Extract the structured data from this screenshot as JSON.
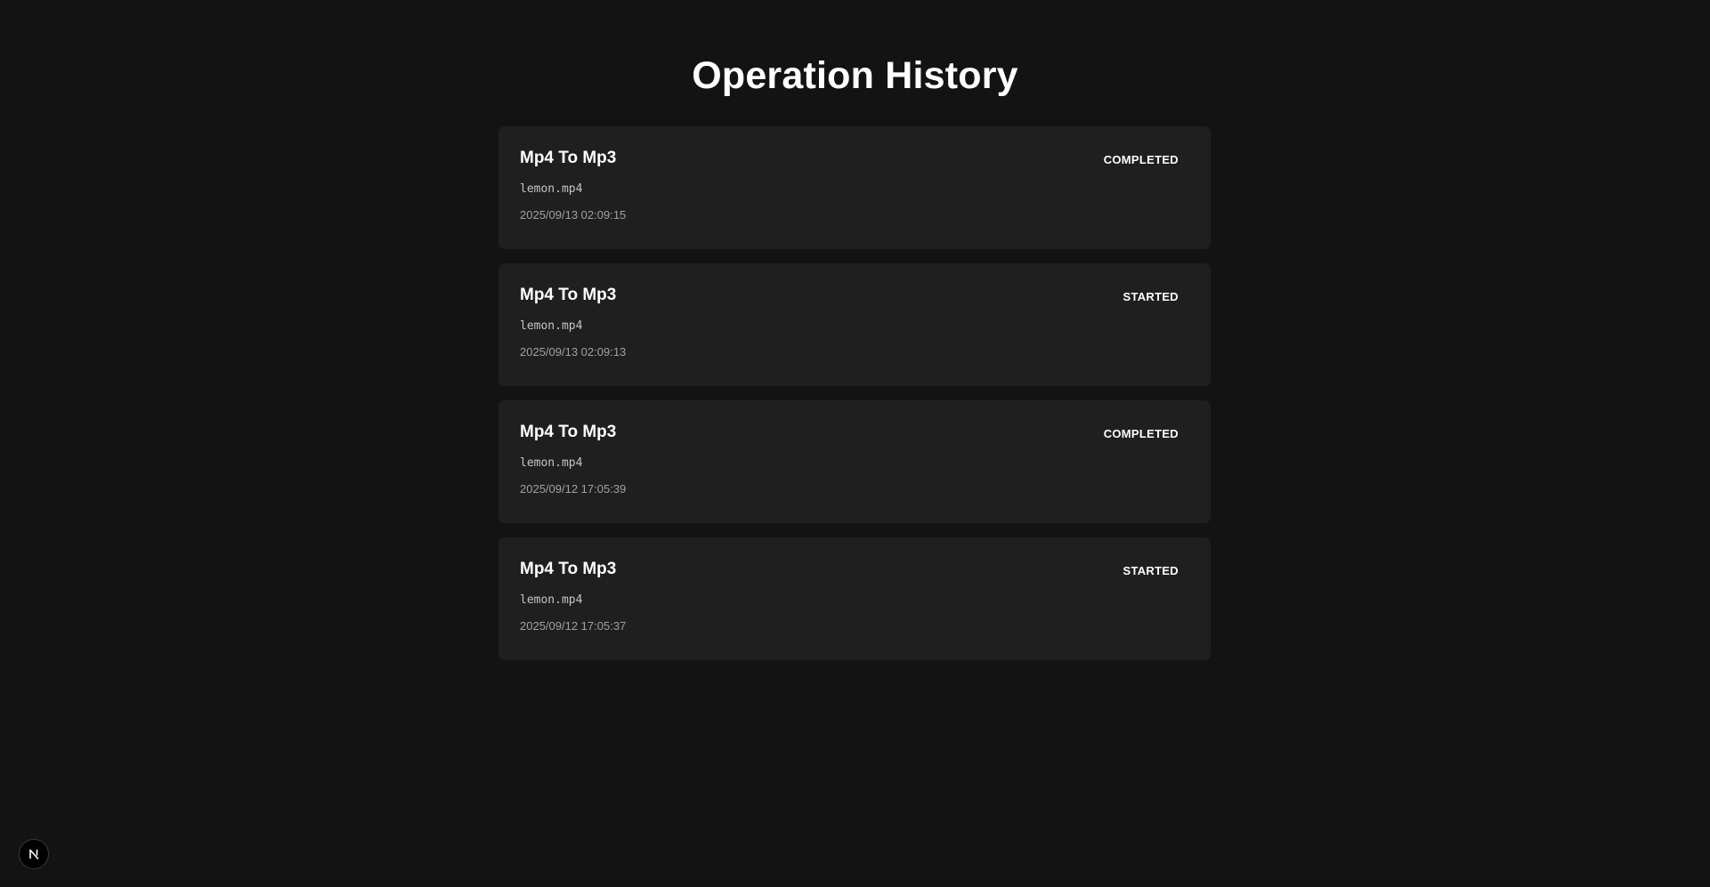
{
  "page": {
    "title": "Operation History"
  },
  "operations": [
    {
      "name": "Mp4 To Mp3",
      "status": "COMPLETED",
      "file": "lemon.mp4",
      "timestamp": "2025/09/13 02:09:15"
    },
    {
      "name": "Mp4 To Mp3",
      "status": "STARTED",
      "file": "lemon.mp4",
      "timestamp": "2025/09/13 02:09:13"
    },
    {
      "name": "Mp4 To Mp3",
      "status": "COMPLETED",
      "file": "lemon.mp4",
      "timestamp": "2025/09/12 17:05:39"
    },
    {
      "name": "Mp4 To Mp3",
      "status": "STARTED",
      "file": "lemon.mp4",
      "timestamp": "2025/09/12 17:05:37"
    }
  ],
  "dev_badge": {
    "icon": "nextjs-logo-icon"
  },
  "colors": {
    "background": "#131313",
    "card": "#1f1f1f",
    "text": "#ffffff",
    "muted": "#a0a0a0"
  }
}
